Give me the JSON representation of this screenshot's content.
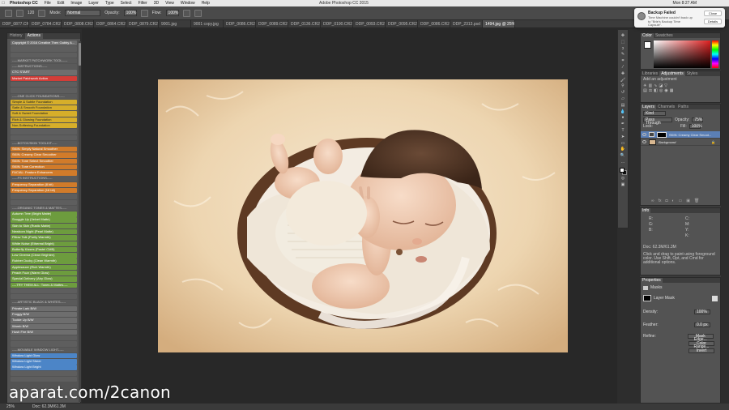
{
  "menubar": {
    "app": "Photoshop CC",
    "items": [
      "File",
      "Edit",
      "Image",
      "Layer",
      "Type",
      "Select",
      "Filter",
      "3D",
      "View",
      "Window",
      "Help"
    ],
    "title": "Adobe Photoshop CC 2015",
    "clock": "Mon 8:27 AM"
  },
  "options": {
    "mode_label": "Mode:",
    "mode_value": "Normal",
    "opacity_label": "Opacity:",
    "opacity_value": "100%",
    "flow_label": "Flow:",
    "flow_value": "100%",
    "size": "120"
  },
  "tabs": [
    "DDP_0877.CR2",
    "DDP_0784.CR2",
    "DDP_0808.CR2",
    "DDP_0864.CR2",
    "DDP_0879.CR2",
    "9001.jpg",
    "9001 copy.jpg",
    "DDP_0086.CR2",
    "DDP_0089.CR2",
    "DDP_0136.CR2",
    "DDP_0190.CR2",
    "DDP_0093.CR2",
    "DDP_0095.CR2",
    "DDP_0086.CR2",
    "DDP_2313.psd",
    "1494.jpg @ 25% (Shiny..."
  ],
  "left_panel": {
    "tabs": [
      "History",
      "Actions"
    ],
    "actions": [
      {
        "c": "gray",
        "t": "Copyright © 2016 Creative Then Gabby A..."
      },
      {
        "c": "empty",
        "t": ""
      },
      {
        "c": "empty",
        "t": ""
      },
      {
        "c": "hdr",
        "t": "-----MARKET PATCHWORK TOOL-----"
      },
      {
        "c": "hdr",
        "t": "-----INSTRUCTIONS-----"
      },
      {
        "c": "gray",
        "t": "CTC START"
      },
      {
        "c": "red",
        "t": "Market Patchwork Action"
      },
      {
        "c": "empty",
        "t": ""
      },
      {
        "c": "empty",
        "t": ""
      },
      {
        "c": "hdr",
        "t": "-----ONE CLICK FOUNDATIONS-----"
      },
      {
        "c": "yellow",
        "t": "Simple & Subtle Foundation"
      },
      {
        "c": "yellow",
        "t": "Satin & Smooth Foundation"
      },
      {
        "c": "yellow",
        "t": "Soft & Sweet Foundation"
      },
      {
        "c": "yellow",
        "t": "Rich & Glowing Foundation"
      },
      {
        "c": "yellow",
        "t": "Non-Softening Foundation"
      },
      {
        "c": "empty",
        "t": ""
      },
      {
        "c": "empty",
        "t": ""
      },
      {
        "c": "hdr",
        "t": "-----BOTOX/SKIN TOOLKIT-----"
      },
      {
        "c": "orange",
        "t": "SKIN: Simply Natural Smoother"
      },
      {
        "c": "orange",
        "t": "SKIN: Creamy Clear Smoother"
      },
      {
        "c": "orange",
        "t": "SKIN: Tone Select Smoother"
      },
      {
        "c": "orange",
        "t": "SKIN: Tone Correction"
      },
      {
        "c": "orange",
        "t": "FACIAL: Feature Enhancers"
      },
      {
        "c": "hdr",
        "t": "-----FS INSTRUCTIONS-----"
      },
      {
        "c": "orange",
        "t": "Frequency Separation  (8 bit)"
      },
      {
        "c": "orange",
        "t": "Frequency Separation  (16 bit)"
      },
      {
        "c": "empty",
        "t": ""
      },
      {
        "c": "empty",
        "t": ""
      },
      {
        "c": "hdr",
        "t": "-----ORGANIC TONES & MATTES-----"
      },
      {
        "c": "green",
        "t": "Autumn Tree   (Bright Matte)"
      },
      {
        "c": "green",
        "t": "Snuggle Up    (Velvet Matte)"
      },
      {
        "c": "green",
        "t": "Skin to Skin   (Rustic Matte)"
      },
      {
        "c": "green",
        "t": "Newborn Night   (Pearl Matte)"
      },
      {
        "c": "green",
        "t": "Pillow Talk    (Purity Warmth)"
      },
      {
        "c": "green",
        "t": "White Noise    (Ethereal Bright)"
      },
      {
        "c": "green",
        "t": "Butterfly Kisses  (Pastel CMB)"
      },
      {
        "c": "green",
        "t": "Low Cinema    (Clean Brighten)"
      },
      {
        "c": "green",
        "t": "Rubber Ducky  (Clean Warmth)"
      },
      {
        "c": "green",
        "t": "Applesauce  (Rich Warmth)"
      },
      {
        "c": "green",
        "t": "Peach Fuzz   (Warm Glow)"
      },
      {
        "c": "green",
        "t": "Special Delivery  (Airy Glow)"
      },
      {
        "c": "green",
        "t": "----TRY THEM ALL: Tones & Mattes----"
      },
      {
        "c": "empty",
        "t": ""
      },
      {
        "c": "empty",
        "t": ""
      },
      {
        "c": "hdr",
        "t": "-----ARTISTIC BLACK & WHITES-----"
      },
      {
        "c": "gray",
        "t": "Private Lark B/W"
      },
      {
        "c": "gray",
        "t": "Froggy B/W"
      },
      {
        "c": "gray",
        "t": "Tuckie Up B/W"
      },
      {
        "c": "gray",
        "t": "Womb B/W"
      },
      {
        "c": "gray",
        "t": "Hush Fire B/W"
      },
      {
        "c": "empty",
        "t": ""
      },
      {
        "c": "empty",
        "t": ""
      },
      {
        "c": "hdr",
        "t": "-----MOVABLE WINDOW LIGHT-----"
      },
      {
        "c": "blue",
        "t": "Window Light Glow"
      },
      {
        "c": "blue",
        "t": "Window Light Sheer"
      },
      {
        "c": "blue",
        "t": "Window Light Bright"
      },
      {
        "c": "empty",
        "t": ""
      },
      {
        "c": "empty",
        "t": ""
      }
    ]
  },
  "right": {
    "color_tabs": [
      "Color",
      "Swatches"
    ],
    "adj_tabs": [
      "Libraries",
      "Adjustments",
      "Styles"
    ],
    "adj_label": "Add an adjustment",
    "layers_tabs": [
      "Layers",
      "Channels",
      "Paths"
    ],
    "kind": "Kind",
    "blend": "Pass Through",
    "opacity_label": "Opacity:",
    "opacity_value": "75%",
    "lock_label": "Lock:",
    "fill_label": "Fill:",
    "fill_value": "100%",
    "layers": [
      "SKIN: Creamy Clear Smoot...",
      "Background"
    ],
    "info_tab": "Info",
    "doc_info": "Doc: 62.3M/61.3M",
    "info_help": "Click and drag to paint using foreground color. Use Shift, Opt, and Cmd for additional options.",
    "props_tab": "Properties",
    "masks_label": "Masks",
    "layer_mask": "Layer Mask",
    "density_label": "Density:",
    "density_value": "100%",
    "feather_label": "Feather:",
    "feather_value": "0.0 px",
    "refine_label": "Refine:",
    "mask_edge": "Mask Edge...",
    "color_range": "Color Range...",
    "invert": "Invert"
  },
  "notification": {
    "title": "Backup Failed",
    "body": "Time Machine couldn't back up to \"Brie's Backup Time Capsule\".",
    "close": "Close",
    "details": "Details"
  },
  "status": {
    "zoom": "25%",
    "doc": "Doc: 62.3M/61.3M"
  },
  "watermark": "aparat.com/2canon"
}
